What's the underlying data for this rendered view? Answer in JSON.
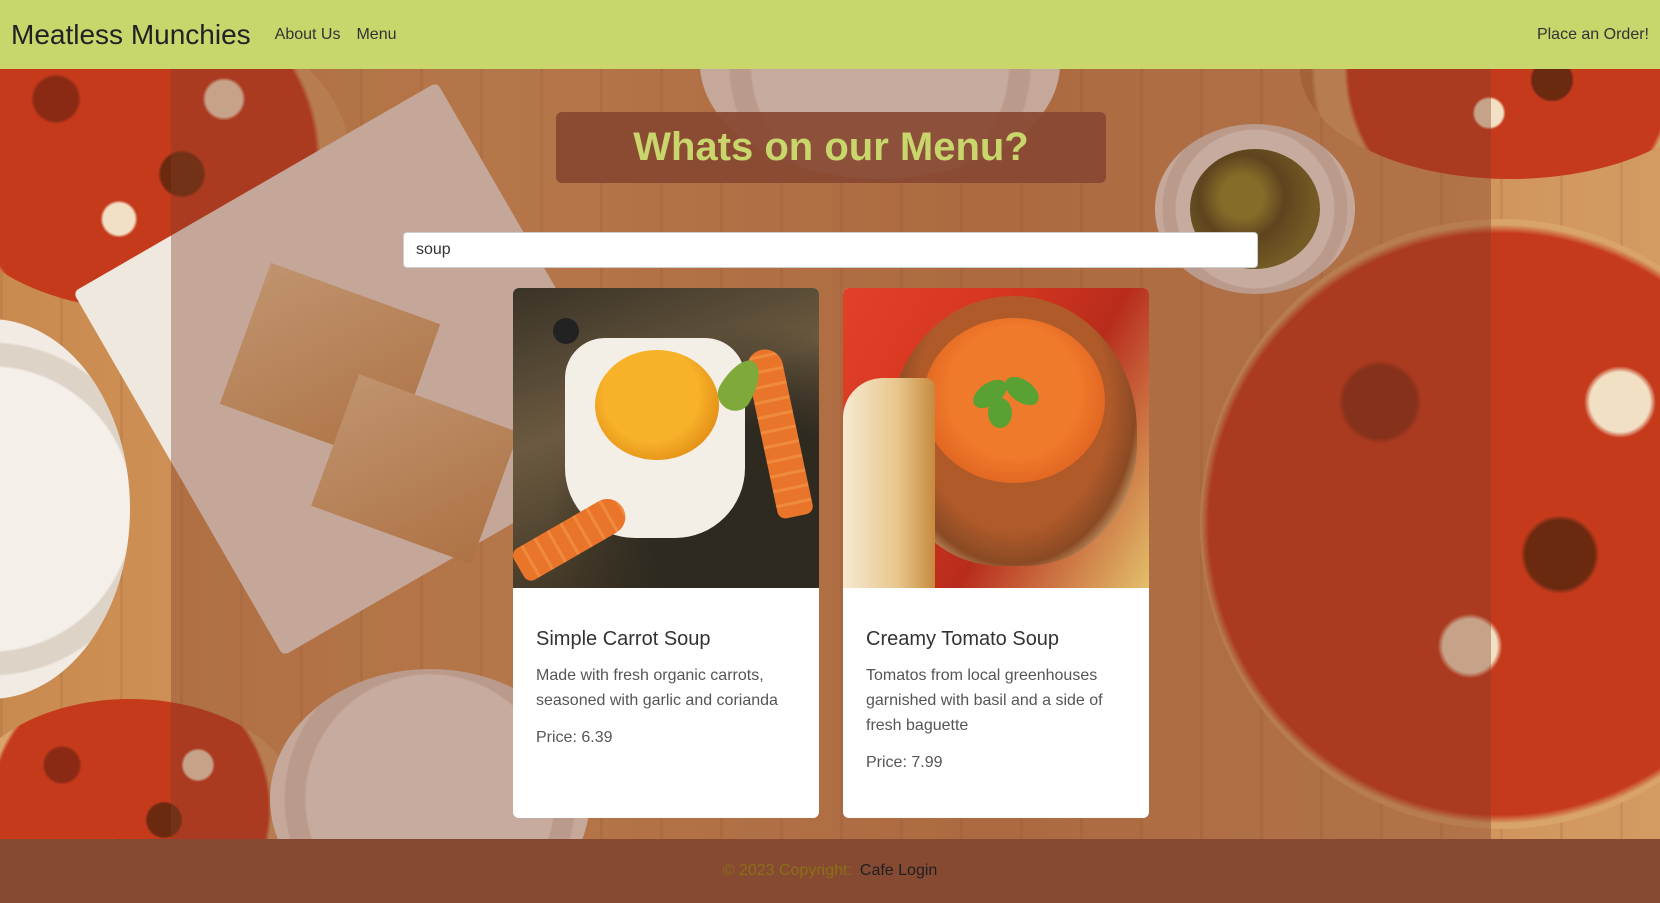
{
  "navbar": {
    "brand": "Meatless Munchies",
    "links": [
      "About Us",
      "Menu"
    ],
    "right_link": "Place an Order!"
  },
  "main": {
    "heading": "Whats on our Menu?",
    "search": {
      "value": "soup",
      "placeholder": ""
    },
    "cards": [
      {
        "title": "Simple Carrot Soup",
        "description": "Made with fresh organic carrots, seasoned with garlic and corianda",
        "price": "Price: 6.39"
      },
      {
        "title": "Creamy Tomato Soup",
        "description": "Tomatos from local greenhouses garnished with basil and a side of fresh baguette",
        "price": "Price: 7.99"
      }
    ]
  },
  "footer": {
    "copyright": "© 2023 Copyright:",
    "login": "Cafe Login"
  },
  "colors": {
    "navbar": "#c8d66c",
    "heading_bg": "#884832",
    "heading_text": "#c8d66c",
    "footer_bg": "#864a33"
  }
}
